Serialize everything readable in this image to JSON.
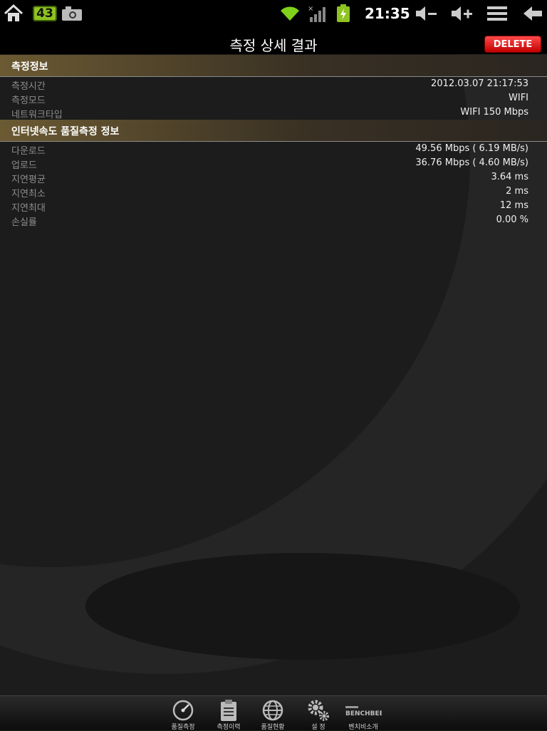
{
  "status_bar": {
    "notification_count": "43",
    "time": "21:35"
  },
  "title_bar": {
    "title": "측정 상세 결과",
    "delete_label": "DELETE"
  },
  "measurement_info": {
    "header": "측정정보",
    "rows": [
      {
        "label": "측정시간",
        "value": "2012.03.07 21:17:53"
      },
      {
        "label": "측정모드",
        "value": "WIFI"
      },
      {
        "label": "네트워크타입",
        "value": "WIFI 150 Mbps"
      }
    ]
  },
  "quality_info": {
    "header": "인터넷속도 품질측정 정보",
    "rows": [
      {
        "label": "다운로드",
        "value": "49.56 Mbps ( 6.19 MB/s)"
      },
      {
        "label": "업로드",
        "value": "36.76 Mbps ( 4.60 MB/s)"
      },
      {
        "label": "지연평균",
        "value": "3.64 ms"
      },
      {
        "label": "지연최소",
        "value": "2 ms"
      },
      {
        "label": "지연최대",
        "value": "12 ms"
      },
      {
        "label": "손실률",
        "value": "0.00 %"
      }
    ]
  },
  "bottom_nav": {
    "items": [
      {
        "label": "품질측정",
        "icon": "speedometer-icon"
      },
      {
        "label": "측정이력",
        "icon": "clipboard-icon"
      },
      {
        "label": "품질현황",
        "icon": "globe-icon"
      },
      {
        "label": "설 정",
        "icon": "gears-icon"
      },
      {
        "label": "벤치비소개",
        "icon": "benchbee-logo",
        "logo_text": "BENCHBEE"
      }
    ]
  },
  "colors": {
    "delete_button": "#e01515",
    "battery": "#8fc31f",
    "wifi": "#7fd11b",
    "section_header": "#5a4a2a"
  }
}
